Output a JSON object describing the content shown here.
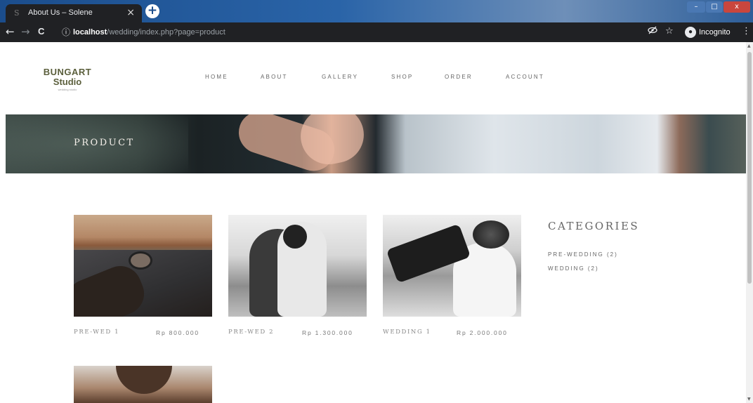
{
  "browser": {
    "tab_title": "About Us – Solene",
    "tab_close": "×",
    "new_tab": "+",
    "favicon": "S",
    "url_host": "localhost",
    "url_path": "/wedding/index.php?page=product",
    "info_icon": "ⓘ",
    "back": "←",
    "forward": "→",
    "reload": "C",
    "eye_off_icon": "eye-off-icon",
    "star_icon": "☆",
    "incognito_label": "Incognito",
    "menu": "⋮",
    "window_min": "–",
    "window_max": "□",
    "window_close": "x"
  },
  "site": {
    "logo_line1": "BUNGART",
    "logo_line2": "Studio",
    "logo_tagline": "wedding studio",
    "nav": [
      "HOME",
      "ABOUT",
      "GALLERY",
      "SHOP",
      "ORDER",
      "ACCOUNT"
    ],
    "banner_title": "PRODUCT"
  },
  "products": [
    {
      "name": "PRE-WED 1",
      "price": "Rp 800.000",
      "image": "road-motorcycle-mirror"
    },
    {
      "name": "PRE-WED 2",
      "price": "Rp 1.300.000",
      "image": "couple-embrace-bw"
    },
    {
      "name": "WEDDING 1",
      "price": "Rp 2.000.000",
      "image": "wedding-kiss-bw"
    },
    {
      "name": "",
      "price": "",
      "image": "couple-portrait"
    }
  ],
  "categories": {
    "title": "CATEGORIES",
    "items": [
      "PRE-WEDDING (2)",
      "WEDDING (2)"
    ]
  },
  "colors": {
    "chrome_dark": "#202124",
    "titlebar_blue": "#1b4d8c",
    "logo_olive": "#5b5f3c",
    "text_gray": "#666666"
  }
}
